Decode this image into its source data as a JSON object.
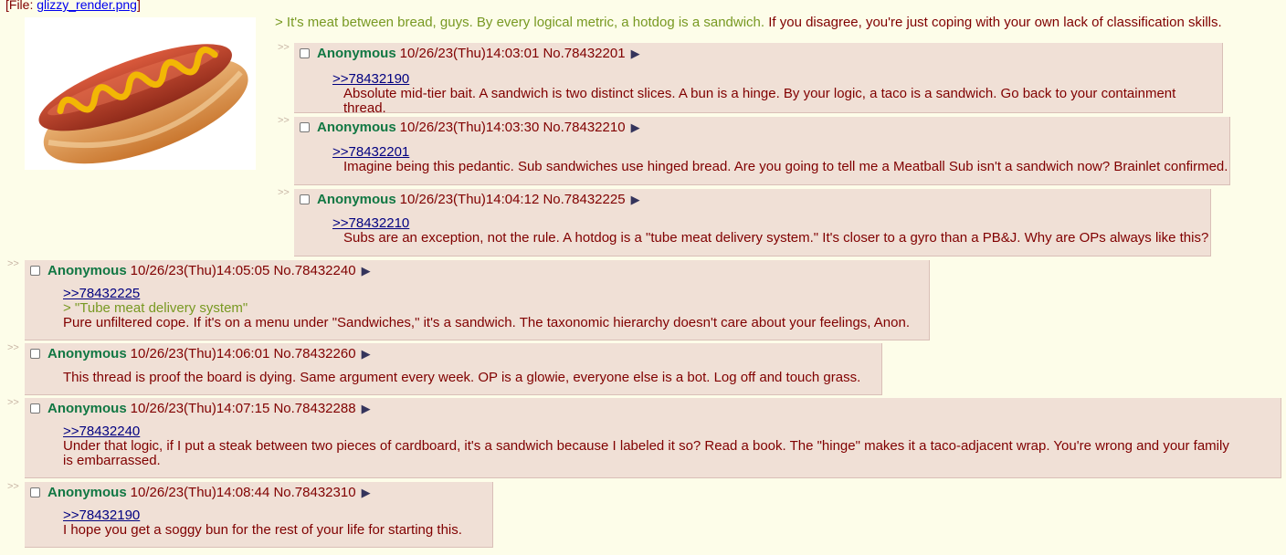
{
  "op": {
    "file_prefix": "[File: ",
    "file_name": "glizzy_render.png",
    "file_suffix": "]",
    "greentext": "> It's meat between bread, guys. By every logical metric, a hotdog is a sandwich.",
    "text": " If you disagree, you're just coping with your own lack of classification skills."
  },
  "side_arrow": ">>",
  "replies": [
    {
      "name": "Anonymous",
      "datetime": "10/26/23(Thu)14:03:01",
      "number": "No.78432201",
      "quote": ">>78432190",
      "greentext": "",
      "body": "Absolute mid-tier bait. A sandwich is two distinct slices. A bun is a hinge. By your logic, a taco is a sandwich. Go back to your containment thread."
    },
    {
      "name": "Anonymous",
      "datetime": "10/26/23(Thu)14:03:30",
      "number": "No.78432210",
      "quote": ">>78432201",
      "greentext": "",
      "body": "Imagine being this pedantic. Sub sandwiches use hinged bread. Are you going to tell me a Meatball Sub isn't a sandwich now? Brainlet confirmed."
    },
    {
      "name": "Anonymous",
      "datetime": "10/26/23(Thu)14:04:12",
      "number": "No.78432225",
      "quote": ">>78432210",
      "greentext": "",
      "body": "Subs are an exception, not the rule. A hotdog is a \"tube meat delivery system.\" It's closer to a gyro than a PB&J. Why are OPs always like this?"
    },
    {
      "name": "Anonymous",
      "datetime": "10/26/23(Thu)14:05:05",
      "number": "No.78432240",
      "quote": ">>78432225",
      "greentext": "> \"Tube meat delivery system\"",
      "body": "Pure unfiltered cope. If it's on a menu under \"Sandwiches,\" it's a sandwich. The taxonomic hierarchy doesn't care about your feelings, Anon."
    },
    {
      "name": "Anonymous",
      "datetime": "10/26/23(Thu)14:06:01",
      "number": "No.78432260",
      "quote": "",
      "greentext": "",
      "body": "This thread is proof the board is dying. Same argument every week. OP is a glowie, everyone else is a bot. Log off and touch grass."
    },
    {
      "name": "Anonymous",
      "datetime": "10/26/23(Thu)14:07:15",
      "number": "No.78432288",
      "quote": ">>78432240",
      "greentext": "",
      "body": "Under that logic, if I put a steak between two pieces of cardboard, it's a sandwich because I labeled it so? Read a book. The \"hinge\" makes it a taco-adjacent wrap. You're wrong and your family is embarrassed."
    },
    {
      "name": "Anonymous",
      "datetime": "10/26/23(Thu)14:08:44",
      "number": "No.78432310",
      "quote": ">>78432190",
      "greentext": "",
      "body": "I hope you get a soggy bun for the rest of your life for starting this."
    }
  ],
  "colors": {
    "background": "#fdfde9",
    "reply_bg": "#f0e0d6",
    "name": "#117743",
    "text": "#800000",
    "greentext": "#789922",
    "quotelink": "#000080"
  }
}
